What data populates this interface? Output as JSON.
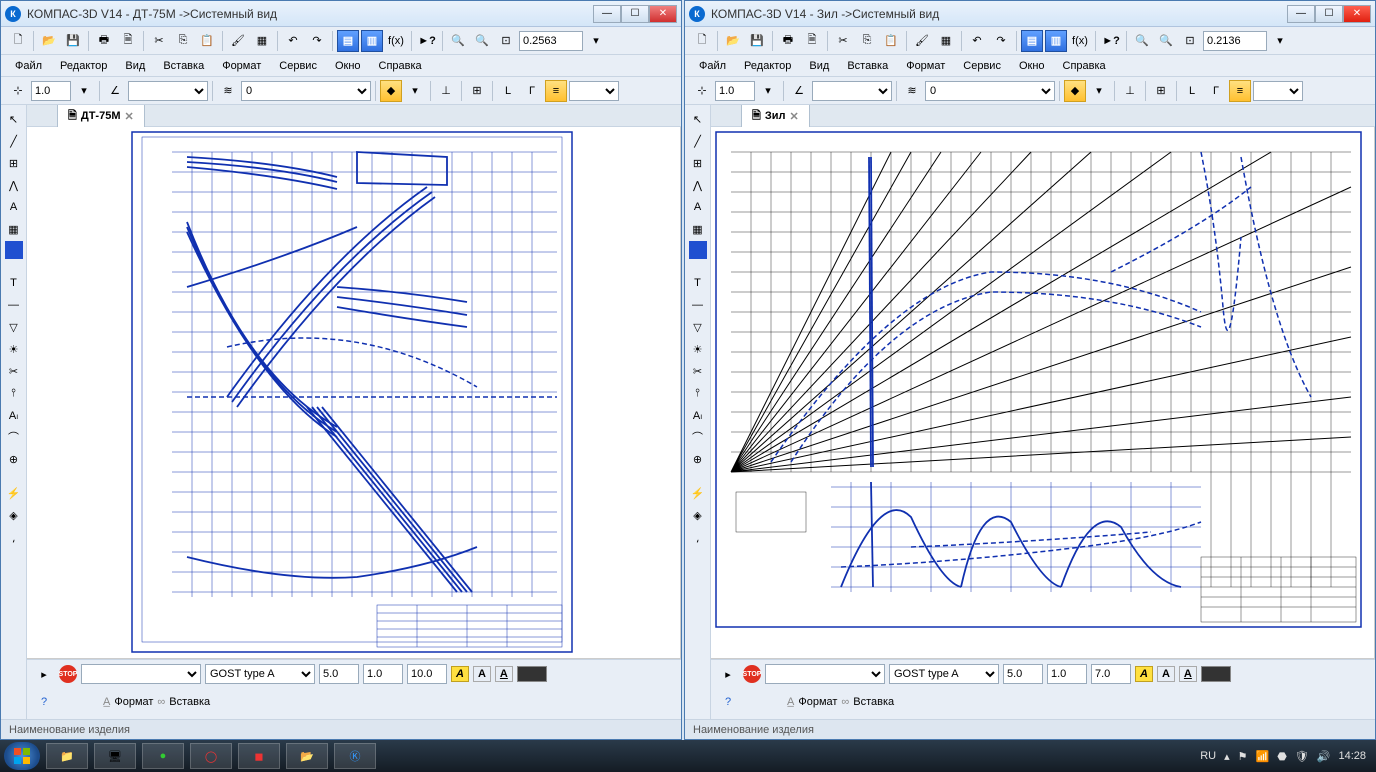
{
  "windows": [
    {
      "id": "left",
      "title": "КОМПАС-3D V14 - ДТ-75М ->Системный вид",
      "zoom": "0.2563",
      "tab_label": "ДТ-75М",
      "status": "Наименование изделия",
      "close_active": false
    },
    {
      "id": "right",
      "title": "КОМПАС-3D V14 - Зил ->Системный вид",
      "zoom": "0.2136",
      "tab_label": "Зил",
      "status": "Наименование изделия",
      "close_active": true
    }
  ],
  "menus": [
    "Файл",
    "Редактор",
    "Вид",
    "Вставка",
    "Формат",
    "Сервис",
    "Окно",
    "Справка"
  ],
  "prop_row": {
    "step": "1.0",
    "layer": "0"
  },
  "text_row": {
    "font": "GOST type A",
    "size1": "5.0",
    "size2": "1.0",
    "size3_left": "10.0",
    "size3_right": "7.0"
  },
  "fmt_tabs": {
    "format": "Формат",
    "insert": "Вставка"
  },
  "taskbar": {
    "lang": "RU",
    "time": "14:28"
  }
}
